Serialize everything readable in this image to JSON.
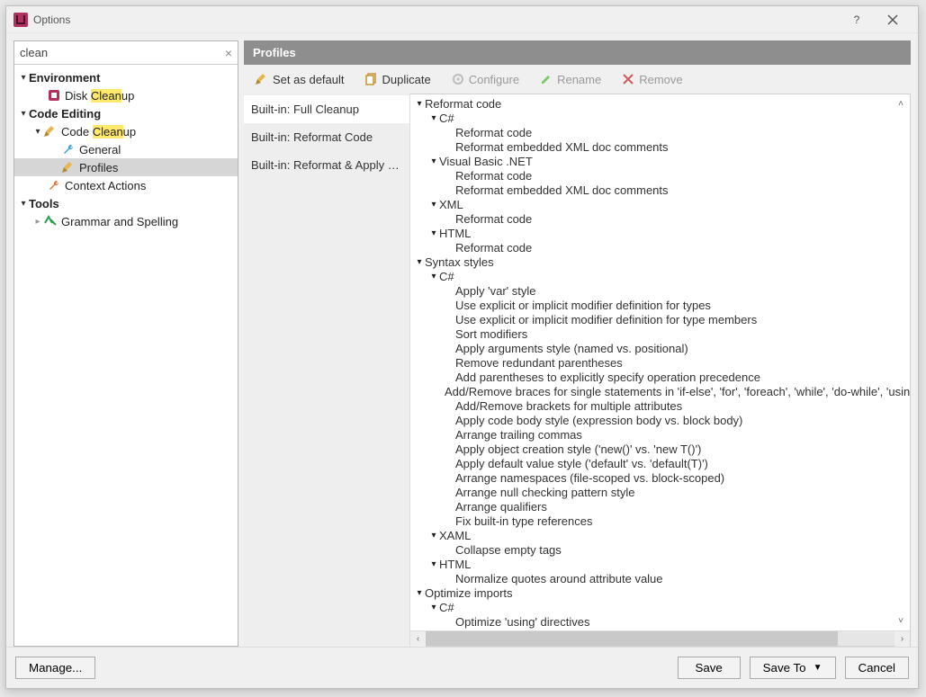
{
  "window": {
    "title": "Options"
  },
  "search": {
    "value": "clean"
  },
  "setting_name_pre": "Code ",
  "setting_name_hl": "Clean",
  "setting_name_post": "up",
  "nav": {
    "environment": "Environment",
    "disk_pre": "Disk ",
    "disk_hl": "Clean",
    "disk_post": "up",
    "code_editing": "Code Editing",
    "general": "General",
    "profiles": "Profiles",
    "context_actions": "Context Actions",
    "tools": "Tools",
    "grammar": "Grammar and Spelling"
  },
  "header": "Profiles",
  "toolbar": {
    "set_default": "Set as default",
    "duplicate": "Duplicate",
    "configure": "Configure",
    "rename": "Rename",
    "remove": "Remove"
  },
  "profiles": {
    "p0": "Built-in: Full Cleanup",
    "p1": "Built-in: Reformat Code",
    "p2": "Built-in: Reformat & Apply Syn..."
  },
  "details": {
    "r0": "Reformat code",
    "r1": "C#",
    "r2": "Reformat code",
    "r3": "Reformat embedded XML doc comments",
    "r4": "Visual Basic .NET",
    "r5": "Reformat code",
    "r6": "Reformat embedded XML doc comments",
    "r7": "XML",
    "r8": "Reformat code",
    "r9": "HTML",
    "r10": "Reformat code",
    "r11": "Syntax styles",
    "r12": "C#",
    "r13": "Apply 'var' style",
    "r14": "Use explicit or implicit modifier definition for types",
    "r15": "Use explicit or implicit modifier definition for type members",
    "r16": "Sort modifiers",
    "r17": "Apply arguments style (named vs. positional)",
    "r18": "Remove redundant parentheses",
    "r19": "Add parentheses to explicitly specify operation precedence",
    "r20": "Add/Remove braces for single statements in 'if-else', 'for', 'foreach', 'while', 'do-while', 'usin",
    "r21": "Add/Remove brackets for multiple attributes",
    "r22": "Apply code body style (expression body vs. block body)",
    "r23": "Arrange trailing commas",
    "r24": "Apply object creation style ('new()' vs. 'new T()')",
    "r25": "Apply default value style ('default' vs. 'default(T)')",
    "r26": "Arrange namespaces (file-scoped vs. block-scoped)",
    "r27": "Arrange null checking pattern style",
    "r28": "Arrange qualifiers",
    "r29": "Fix built-in type references",
    "r30": "XAML",
    "r31": "Collapse empty tags",
    "r32": "HTML",
    "r33": "Normalize quotes around attribute value",
    "r34": "Optimize imports",
    "r35": "C#",
    "r36": "Optimize 'using' directives"
  },
  "footer": {
    "manage": "Manage...",
    "save": "Save",
    "save_to": "Save To",
    "cancel": "Cancel"
  }
}
